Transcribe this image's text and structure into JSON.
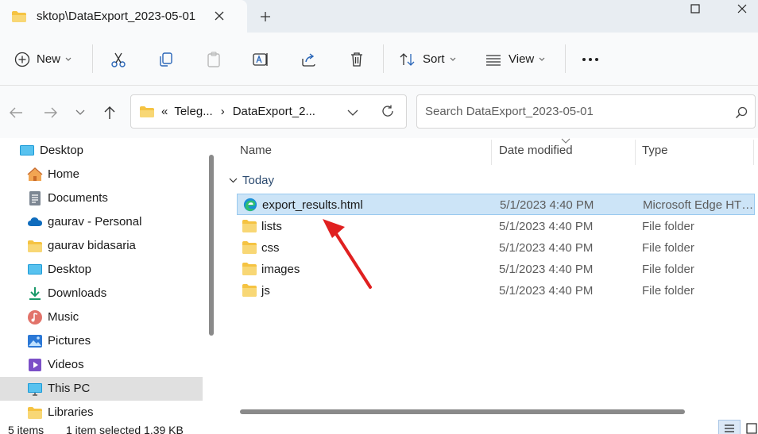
{
  "window": {
    "tab_title": "sktop\\DataExport_2023-05-01",
    "tab_icon": "folder-icon",
    "close_tab_label": "×",
    "new_tab_label": "+",
    "minimize_label": "–",
    "maximize_label": "□",
    "close_label": "✕"
  },
  "toolbar": {
    "new_label": "New",
    "sort_label": "Sort",
    "view_label": "View",
    "more_label": "•••",
    "icons": [
      "plus-circle-icon",
      "cut-icon",
      "copy-icon",
      "paste-icon",
      "rename-icon",
      "share-icon",
      "delete-icon",
      "sort-icon",
      "view-icon",
      "more-icon"
    ]
  },
  "address": {
    "overflow": "«",
    "crumbs": [
      "Teleg...",
      "DataExport_2..."
    ],
    "separator": "›"
  },
  "search": {
    "placeholder": "Search DataExport_2023-05-01"
  },
  "nav_pane": {
    "items": [
      {
        "label": "Desktop",
        "icon": "desktop-icon"
      },
      {
        "label": "Home",
        "icon": "home-icon"
      },
      {
        "label": "Documents",
        "icon": "documents-icon"
      },
      {
        "label": "gaurav - Personal",
        "icon": "onedrive-cloud-icon"
      },
      {
        "label": "gaurav bidasaria",
        "icon": "folder-icon"
      },
      {
        "label": "Desktop",
        "icon": "desktop-icon"
      },
      {
        "label": "Downloads",
        "icon": "downloads-icon"
      },
      {
        "label": "Music",
        "icon": "music-icon"
      },
      {
        "label": "Pictures",
        "icon": "pictures-icon"
      },
      {
        "label": "Videos",
        "icon": "videos-icon"
      },
      {
        "label": "This PC",
        "icon": "this-pc-icon",
        "selected": true
      },
      {
        "label": "Libraries",
        "icon": "libraries-icon"
      }
    ]
  },
  "file_list": {
    "columns": [
      "Name",
      "Date modified",
      "Type"
    ],
    "group": "Today",
    "rows": [
      {
        "name": "export_results.html",
        "date": "5/1/2023 4:40 PM",
        "type": "Microsoft Edge HTML Document",
        "icon": "edge-html-icon",
        "selected": true
      },
      {
        "name": "lists",
        "date": "5/1/2023 4:40 PM",
        "type": "File folder",
        "icon": "folder-icon"
      },
      {
        "name": "css",
        "date": "5/1/2023 4:40 PM",
        "type": "File folder",
        "icon": "folder-icon"
      },
      {
        "name": "images",
        "date": "5/1/2023 4:40 PM",
        "type": "File folder",
        "icon": "folder-icon"
      },
      {
        "name": "js",
        "date": "5/1/2023 4:40 PM",
        "type": "File folder",
        "icon": "folder-icon"
      }
    ]
  },
  "status": {
    "item_count": "5 items",
    "selection": "1 item selected  1.39 KB"
  },
  "colors": {
    "selection_bg": "#cce4f7",
    "selection_border": "#99c9ef",
    "folder_yellow": "#f5c342",
    "annotation_red": "#e02020"
  }
}
